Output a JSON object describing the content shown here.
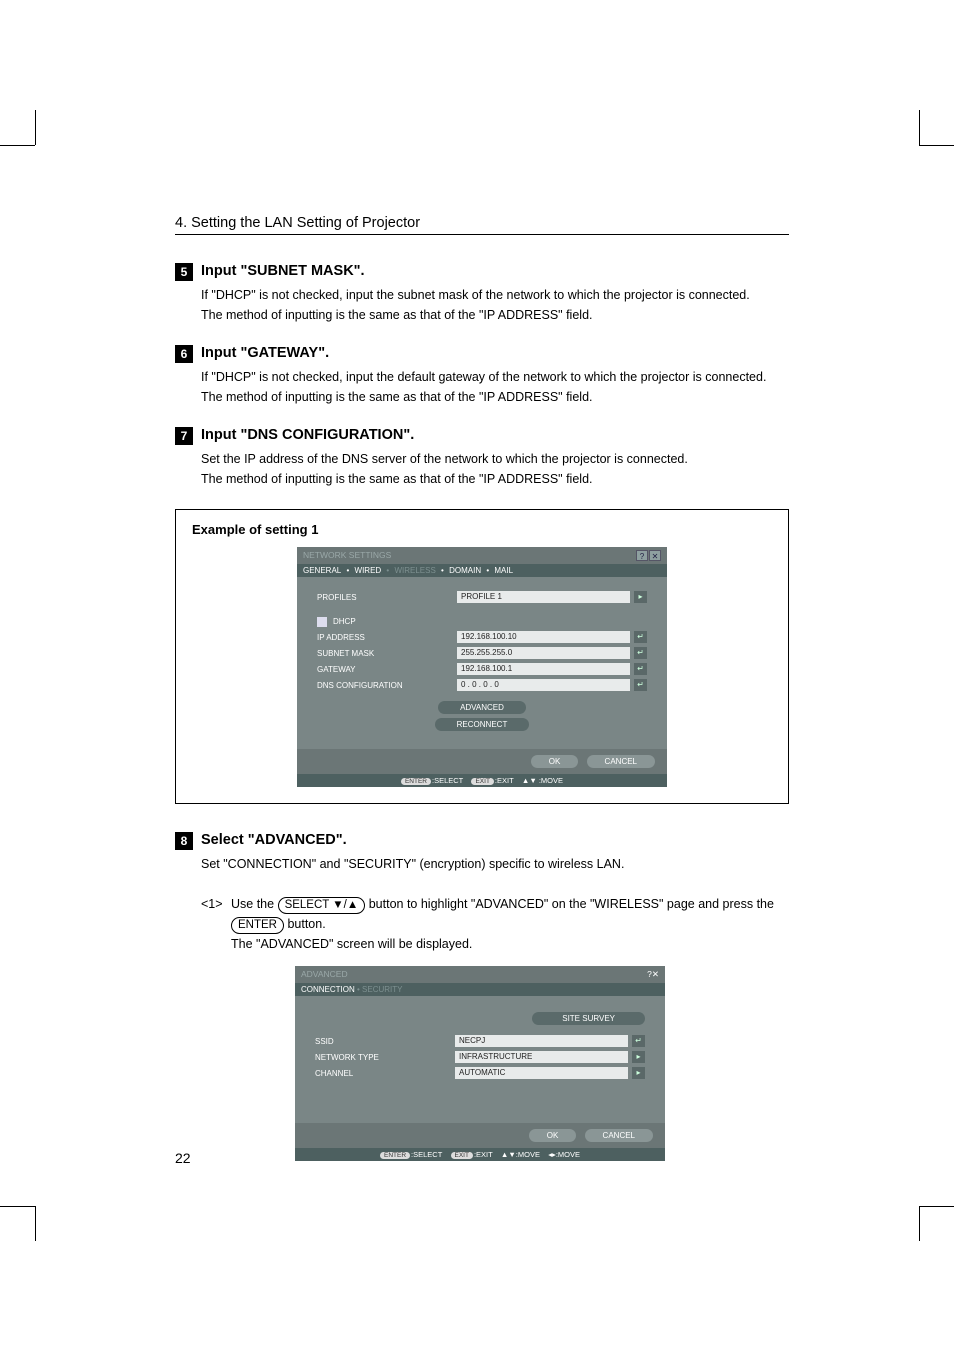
{
  "chapter_head": "4. Setting the LAN Setting of Projector",
  "page_number": "22",
  "steps": {
    "s5": {
      "num": "5",
      "title": "Input \"SUBNET MASK\".",
      "line1": "If \"DHCP\" is not checked, input the subnet mask of the network to which the projector is connected.",
      "line2": "The method of inputting is the same as that of the \"IP ADDRESS\" field."
    },
    "s6": {
      "num": "6",
      "title": "Input \"GATEWAY\".",
      "line1": "If \"DHCP\" is not checked, input the default gateway of the network to which the projector is connected.",
      "line2": "The method of inputting is the same as that of the \"IP ADDRESS\" field."
    },
    "s7": {
      "num": "7",
      "title": "Input \"DNS CONFIGURATION\".",
      "line1": "Set the IP address of the DNS server of the network to which the projector is connected.",
      "line2": "The method of inputting is the same as that of the \"IP ADDRESS\" field."
    },
    "s8": {
      "num": "8",
      "title": "Select \"ADVANCED\".",
      "line1": "Set \"CONNECTION\" and \"SECURITY\" (encryption) specific to wireless LAN.",
      "sub1_num": "<1>",
      "sub1_a": "Use the ",
      "sub1_key1": "SELECT ▼/▲",
      "sub1_b": " button to highlight \"ADVANCED\" on the \"WIRELESS\" page and press the ",
      "sub1_key2": "ENTER",
      "sub1_c": " button.",
      "sub1_d": "The \"ADVANCED\" screen will be displayed."
    }
  },
  "example_title": "Example of setting 1",
  "osd1": {
    "title": "NETWORK SETTINGS",
    "tabs": {
      "general": "GENERAL",
      "wired": "WIRED",
      "wireless": "WIRELESS",
      "domain": "DOMAIN",
      "mail": "MAIL"
    },
    "profiles_label": "PROFILES",
    "profiles_value": "PROFILE 1",
    "dhcp": "DHCP",
    "ip_label": "IP ADDRESS",
    "ip_value": "192.168.100.10",
    "subnet_label": "SUBNET MASK",
    "subnet_value": "255.255.255.0",
    "gateway_label": "GATEWAY",
    "gateway_value": "192.168.100.1",
    "dns_label": "DNS CONFIGURATION",
    "dns_value": "0 . 0 . 0 . 0",
    "advanced_btn": "ADVANCED",
    "reconnect_btn": "RECONNECT",
    "ok": "OK",
    "cancel": "CANCEL",
    "hint_select": ":SELECT",
    "hint_exit": ":EXIT",
    "hint_move": "  :MOVE",
    "pill_enter": "ENTER",
    "pill_exit": "EXIT",
    "pill_arrow": "▲▼"
  },
  "osd2": {
    "title": "ADVANCED",
    "tab_conn": "CONNECTION",
    "tab_sec": "SECURITY",
    "site_survey": "SITE SURVEY",
    "ssid_label": "SSID",
    "ssid_value": "NECPJ",
    "nettype_label": "NETWORK TYPE",
    "nettype_value": "INFRASTRUCTURE",
    "channel_label": "CHANNEL",
    "channel_value": "AUTOMATIC",
    "ok": "OK",
    "cancel": "CANCEL",
    "hint_select": ":SELECT",
    "hint_exit": ":EXIT",
    "hint_move": ":MOVE",
    "hint_move2": ":MOVE",
    "pill_enter": "ENTER",
    "pill_exit": "EXIT"
  },
  "icons": {
    "help": "?",
    "close": "✕",
    "chev": "▸",
    "enter": "↵",
    "updown": "▲▼",
    "leftright": "◂▸"
  }
}
